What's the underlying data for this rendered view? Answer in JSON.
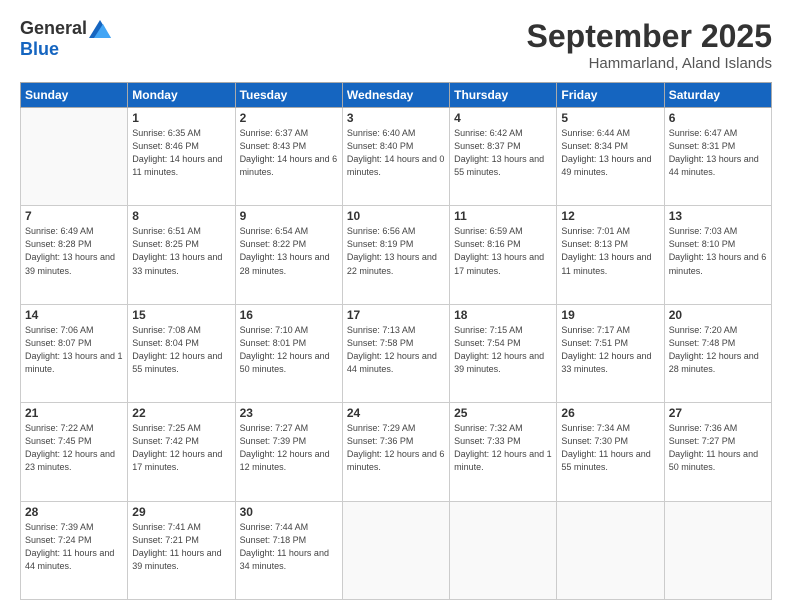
{
  "logo": {
    "general": "General",
    "blue": "Blue"
  },
  "header": {
    "month": "September 2025",
    "location": "Hammarland, Aland Islands"
  },
  "weekdays": [
    "Sunday",
    "Monday",
    "Tuesday",
    "Wednesday",
    "Thursday",
    "Friday",
    "Saturday"
  ],
  "weeks": [
    [
      {
        "day": "",
        "sunrise": "",
        "sunset": "",
        "daylight": ""
      },
      {
        "day": "1",
        "sunrise": "Sunrise: 6:35 AM",
        "sunset": "Sunset: 8:46 PM",
        "daylight": "Daylight: 14 hours and 11 minutes."
      },
      {
        "day": "2",
        "sunrise": "Sunrise: 6:37 AM",
        "sunset": "Sunset: 8:43 PM",
        "daylight": "Daylight: 14 hours and 6 minutes."
      },
      {
        "day": "3",
        "sunrise": "Sunrise: 6:40 AM",
        "sunset": "Sunset: 8:40 PM",
        "daylight": "Daylight: 14 hours and 0 minutes."
      },
      {
        "day": "4",
        "sunrise": "Sunrise: 6:42 AM",
        "sunset": "Sunset: 8:37 PM",
        "daylight": "Daylight: 13 hours and 55 minutes."
      },
      {
        "day": "5",
        "sunrise": "Sunrise: 6:44 AM",
        "sunset": "Sunset: 8:34 PM",
        "daylight": "Daylight: 13 hours and 49 minutes."
      },
      {
        "day": "6",
        "sunrise": "Sunrise: 6:47 AM",
        "sunset": "Sunset: 8:31 PM",
        "daylight": "Daylight: 13 hours and 44 minutes."
      }
    ],
    [
      {
        "day": "7",
        "sunrise": "Sunrise: 6:49 AM",
        "sunset": "Sunset: 8:28 PM",
        "daylight": "Daylight: 13 hours and 39 minutes."
      },
      {
        "day": "8",
        "sunrise": "Sunrise: 6:51 AM",
        "sunset": "Sunset: 8:25 PM",
        "daylight": "Daylight: 13 hours and 33 minutes."
      },
      {
        "day": "9",
        "sunrise": "Sunrise: 6:54 AM",
        "sunset": "Sunset: 8:22 PM",
        "daylight": "Daylight: 13 hours and 28 minutes."
      },
      {
        "day": "10",
        "sunrise": "Sunrise: 6:56 AM",
        "sunset": "Sunset: 8:19 PM",
        "daylight": "Daylight: 13 hours and 22 minutes."
      },
      {
        "day": "11",
        "sunrise": "Sunrise: 6:59 AM",
        "sunset": "Sunset: 8:16 PM",
        "daylight": "Daylight: 13 hours and 17 minutes."
      },
      {
        "day": "12",
        "sunrise": "Sunrise: 7:01 AM",
        "sunset": "Sunset: 8:13 PM",
        "daylight": "Daylight: 13 hours and 11 minutes."
      },
      {
        "day": "13",
        "sunrise": "Sunrise: 7:03 AM",
        "sunset": "Sunset: 8:10 PM",
        "daylight": "Daylight: 13 hours and 6 minutes."
      }
    ],
    [
      {
        "day": "14",
        "sunrise": "Sunrise: 7:06 AM",
        "sunset": "Sunset: 8:07 PM",
        "daylight": "Daylight: 13 hours and 1 minute."
      },
      {
        "day": "15",
        "sunrise": "Sunrise: 7:08 AM",
        "sunset": "Sunset: 8:04 PM",
        "daylight": "Daylight: 12 hours and 55 minutes."
      },
      {
        "day": "16",
        "sunrise": "Sunrise: 7:10 AM",
        "sunset": "Sunset: 8:01 PM",
        "daylight": "Daylight: 12 hours and 50 minutes."
      },
      {
        "day": "17",
        "sunrise": "Sunrise: 7:13 AM",
        "sunset": "Sunset: 7:58 PM",
        "daylight": "Daylight: 12 hours and 44 minutes."
      },
      {
        "day": "18",
        "sunrise": "Sunrise: 7:15 AM",
        "sunset": "Sunset: 7:54 PM",
        "daylight": "Daylight: 12 hours and 39 minutes."
      },
      {
        "day": "19",
        "sunrise": "Sunrise: 7:17 AM",
        "sunset": "Sunset: 7:51 PM",
        "daylight": "Daylight: 12 hours and 33 minutes."
      },
      {
        "day": "20",
        "sunrise": "Sunrise: 7:20 AM",
        "sunset": "Sunset: 7:48 PM",
        "daylight": "Daylight: 12 hours and 28 minutes."
      }
    ],
    [
      {
        "day": "21",
        "sunrise": "Sunrise: 7:22 AM",
        "sunset": "Sunset: 7:45 PM",
        "daylight": "Daylight: 12 hours and 23 minutes."
      },
      {
        "day": "22",
        "sunrise": "Sunrise: 7:25 AM",
        "sunset": "Sunset: 7:42 PM",
        "daylight": "Daylight: 12 hours and 17 minutes."
      },
      {
        "day": "23",
        "sunrise": "Sunrise: 7:27 AM",
        "sunset": "Sunset: 7:39 PM",
        "daylight": "Daylight: 12 hours and 12 minutes."
      },
      {
        "day": "24",
        "sunrise": "Sunrise: 7:29 AM",
        "sunset": "Sunset: 7:36 PM",
        "daylight": "Daylight: 12 hours and 6 minutes."
      },
      {
        "day": "25",
        "sunrise": "Sunrise: 7:32 AM",
        "sunset": "Sunset: 7:33 PM",
        "daylight": "Daylight: 12 hours and 1 minute."
      },
      {
        "day": "26",
        "sunrise": "Sunrise: 7:34 AM",
        "sunset": "Sunset: 7:30 PM",
        "daylight": "Daylight: 11 hours and 55 minutes."
      },
      {
        "day": "27",
        "sunrise": "Sunrise: 7:36 AM",
        "sunset": "Sunset: 7:27 PM",
        "daylight": "Daylight: 11 hours and 50 minutes."
      }
    ],
    [
      {
        "day": "28",
        "sunrise": "Sunrise: 7:39 AM",
        "sunset": "Sunset: 7:24 PM",
        "daylight": "Daylight: 11 hours and 44 minutes."
      },
      {
        "day": "29",
        "sunrise": "Sunrise: 7:41 AM",
        "sunset": "Sunset: 7:21 PM",
        "daylight": "Daylight: 11 hours and 39 minutes."
      },
      {
        "day": "30",
        "sunrise": "Sunrise: 7:44 AM",
        "sunset": "Sunset: 7:18 PM",
        "daylight": "Daylight: 11 hours and 34 minutes."
      },
      {
        "day": "",
        "sunrise": "",
        "sunset": "",
        "daylight": ""
      },
      {
        "day": "",
        "sunrise": "",
        "sunset": "",
        "daylight": ""
      },
      {
        "day": "",
        "sunrise": "",
        "sunset": "",
        "daylight": ""
      },
      {
        "day": "",
        "sunrise": "",
        "sunset": "",
        "daylight": ""
      }
    ]
  ]
}
